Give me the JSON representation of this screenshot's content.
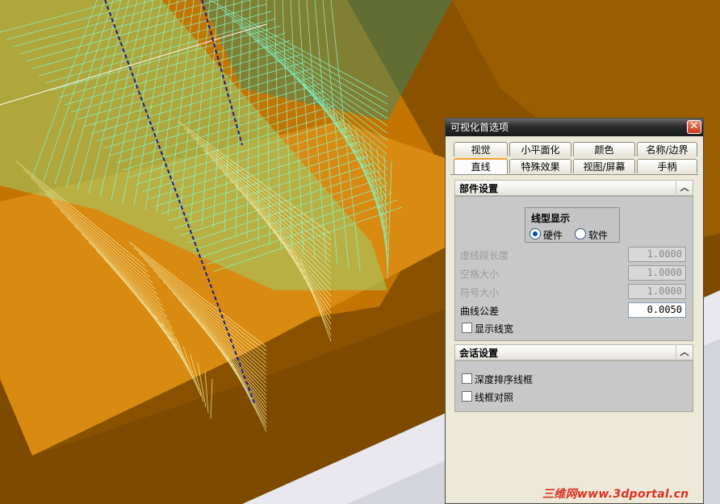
{
  "dialog": {
    "title": "可视化首选项",
    "tabs_row1": [
      "视觉",
      "小平面化",
      "颜色",
      "名称/边界"
    ],
    "tabs_row2": [
      "直线",
      "特殊效果",
      "视图/屏幕",
      "手柄"
    ],
    "active_tab": "直线"
  },
  "part_settings": {
    "header": "部件设置",
    "linetype_group": {
      "title": "线型显示",
      "options": [
        "硬件",
        "软件"
      ],
      "selected": "硬件"
    },
    "fields": [
      {
        "label": "虚线段长度",
        "value": "1.0000",
        "enabled": false
      },
      {
        "label": "空格大小",
        "value": "1.0000",
        "enabled": false
      },
      {
        "label": "符号大小",
        "value": "1.0000",
        "enabled": false
      },
      {
        "label": "曲线公差",
        "value": "0.0050",
        "enabled": true
      }
    ],
    "show_line_width": {
      "label": "显示线宽",
      "checked": false
    }
  },
  "session_settings": {
    "header": "会话设置",
    "options": [
      {
        "label": "深度排序线框",
        "checked": false
      },
      {
        "label": "线框对照",
        "checked": false
      }
    ]
  },
  "watermark": "三维网www.3dportal.cn",
  "colors": {
    "background_orange": "#c87200",
    "background_brown": "#7a4800",
    "wireframe_cyan": "#7fffd4",
    "wireframe_yellow": "#f0e090",
    "dashed_axis": "#2020a0",
    "dialog_bg": "#ece9d8"
  }
}
